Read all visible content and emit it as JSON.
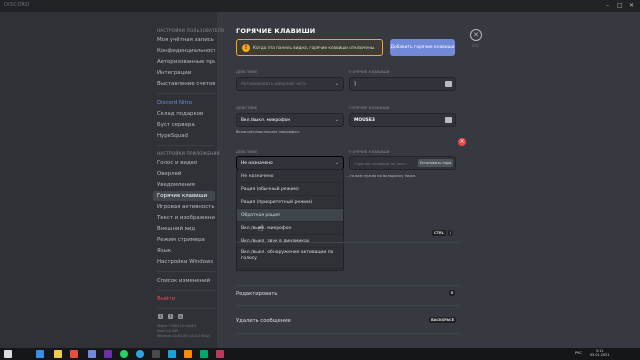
{
  "app": {
    "title": "DISCORD"
  },
  "sidebar": {
    "user_settings_heading": "НАСТРОЙКИ ПОЛЬЗОВАТЕЛЯ",
    "user_items": [
      "Моя учётная запись",
      "Конфиденциальность",
      "Авторизованные прил…",
      "Интеграции",
      "Выставление счетов"
    ],
    "nitro_label": "Discord Nitro",
    "nitro_items": [
      "Склад подарков",
      "Буст сервера",
      "HypeSquad"
    ],
    "app_settings_heading": "НАСТРОЙКИ ПРИЛОЖЕНИЯ",
    "app_items": [
      "Голос и видео",
      "Оверлей",
      "Уведомления",
      "Горячие клавиши",
      "Игровая активность",
      "Текст и изображения",
      "Внешний вид",
      "Режим стримера",
      "Язык",
      "Настройки Windows"
    ],
    "active_item": "Горячие клавиши",
    "changelog_label": "Список изменений",
    "logout_label": "Выйти",
    "version_lines": [
      "Stable 74864 (9c3ad4f)",
      "Host 0.0.309",
      "Windows 10 64-Bit (10.0.19042)"
    ]
  },
  "main": {
    "title": "ГОРЯЧИЕ КЛАВИШИ",
    "warning_text": "Когда эта панель видна, горячие клавиши отключены.",
    "add_button": "Добавить горячие клавиши",
    "close_label": "ESC",
    "action_label": "ДЕЙСТВИЕ",
    "hotkey_label": "ГОРЯЧИЕ КЛАВИШИ",
    "row1": {
      "action": "Активировать оверлей чата",
      "key": "]"
    },
    "row2": {
      "action": "Вкл./выкл. микрофон",
      "key": "MOUSE3",
      "desc": "Включает/выключает микрофон."
    },
    "row3": {
      "action": "Не назначено",
      "key_placeholder": "Горячие клавиши не назн…",
      "record_button": "Установить горя",
      "desc": "…то вам нужно во вкладочку ниже."
    },
    "dropdown_options": [
      "Не назначено",
      "Рация (обычный режим)",
      "Рация (приоритетный режим)",
      "Обратная рация",
      "Вкл./выкл. микрофон",
      "Вкл./выкл. звук в динамиках",
      "Вкл./выкл. обнаружение активации по голосу"
    ],
    "hover_option": "Обратная рация",
    "keybinds": [
      {
        "label": "",
        "key": "CTRL"
      },
      {
        "label": "Редактировать",
        "key": "E"
      },
      {
        "label": "Удалить сообщение",
        "key": "BACKSPACE"
      }
    ]
  },
  "taskbar": {
    "time": "3:11",
    "date": "05.01.2021",
    "lang": "РУС"
  },
  "colors": {
    "accent": "#7289da",
    "warning": "#faa61a",
    "danger": "#f04747"
  }
}
